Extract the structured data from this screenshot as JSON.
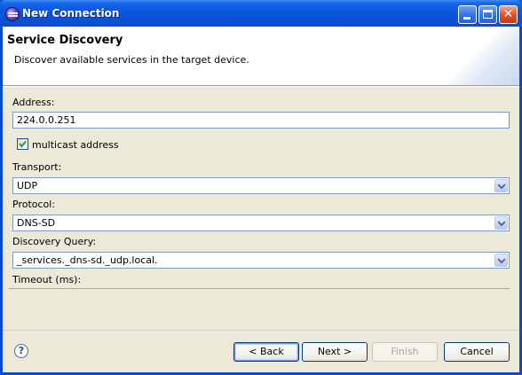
{
  "window": {
    "title": "New Connection"
  },
  "header": {
    "title": "Service Discovery",
    "description": "Discover available services in the target device."
  },
  "form": {
    "address_label": "Address:",
    "address_value": "224.0.0.251",
    "multicast_label": "multicast address",
    "multicast_checked": true,
    "transport_label": "Transport:",
    "transport_value": "UDP",
    "protocol_label": "Protocol:",
    "protocol_value": "DNS-SD",
    "query_label": "Discovery Query:",
    "query_value": "_services._dns-sd._udp.local.",
    "timeout_label": "Timeout (ms):"
  },
  "buttons": {
    "back": "< Back",
    "next": "Next >",
    "finish": "Finish",
    "cancel": "Cancel"
  },
  "icons": {
    "app": "eclipse-icon",
    "help": "help-icon",
    "minimize": "minimize-icon",
    "maximize": "maximize-icon",
    "close": "close-icon"
  }
}
